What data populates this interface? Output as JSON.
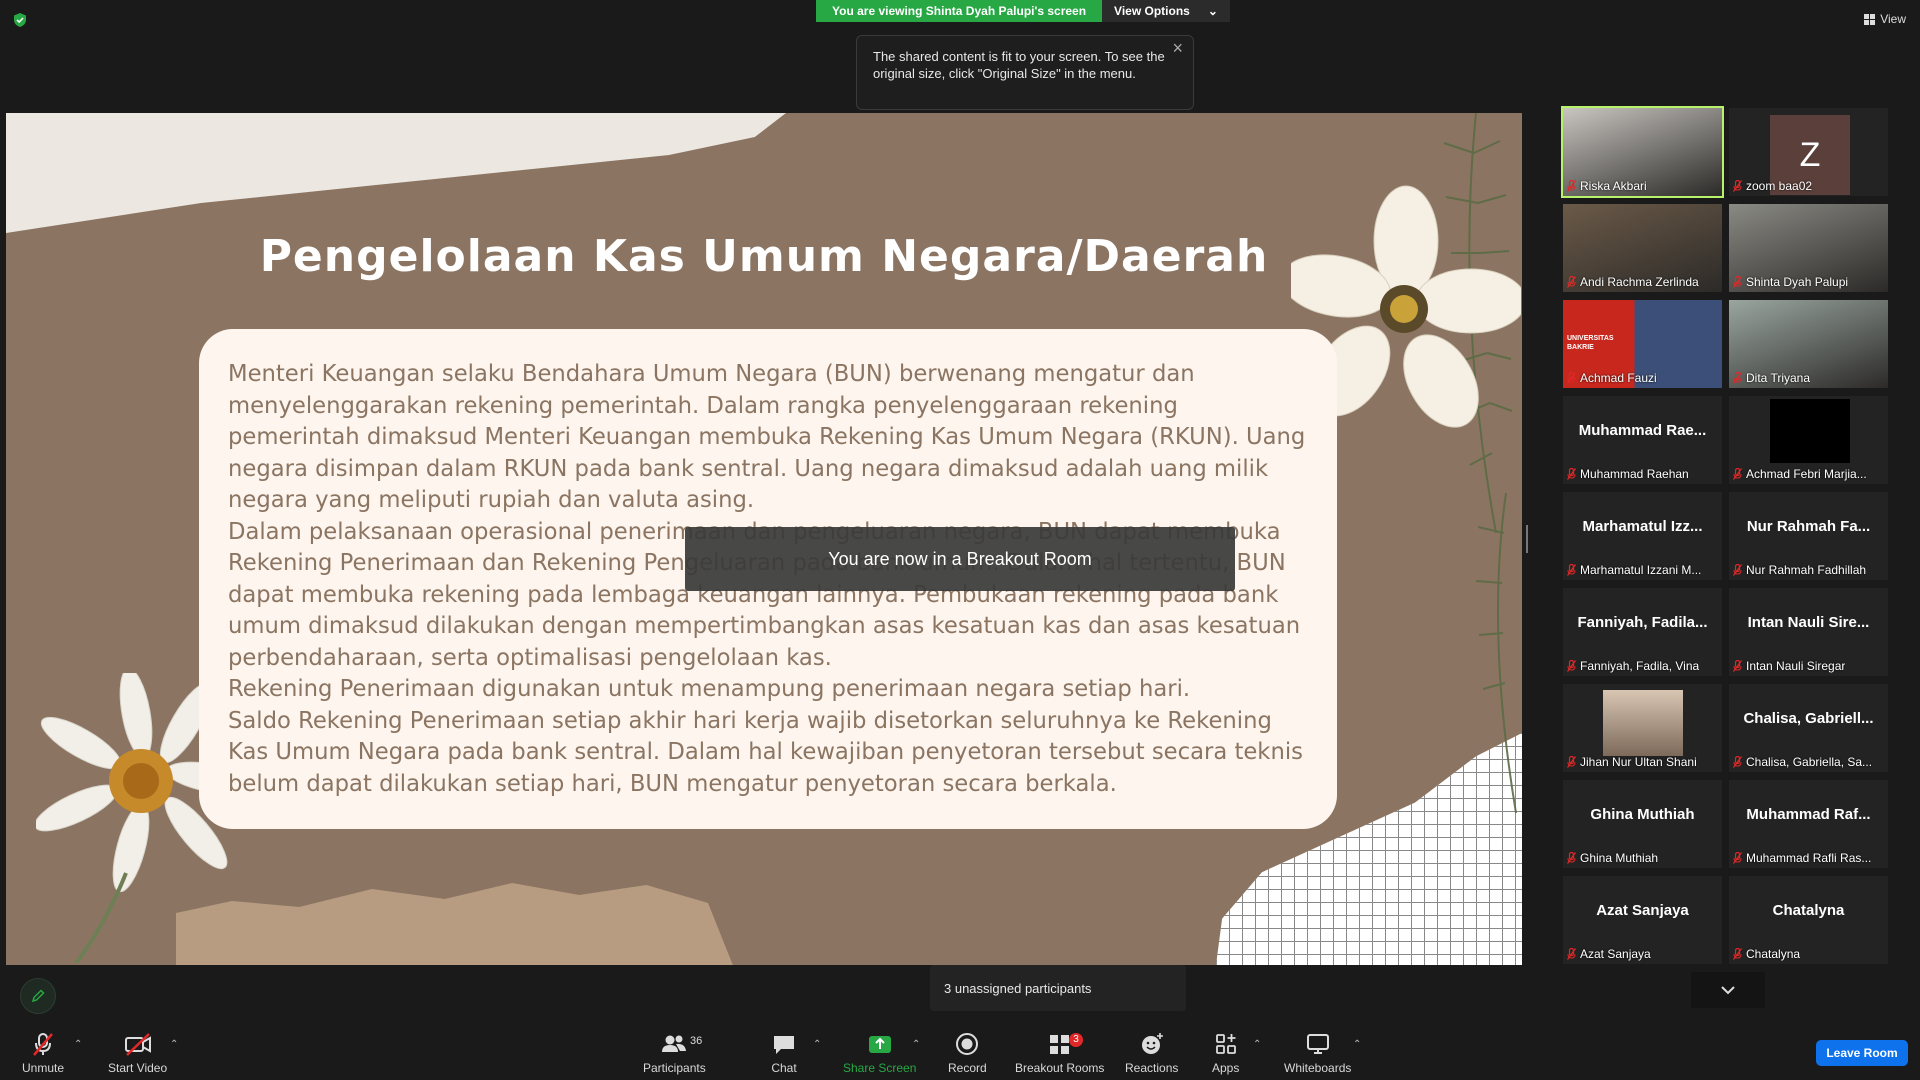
{
  "banner": {
    "viewing_text": "You are viewing Shinta Dyah Palupi's screen",
    "view_options_label": "View Options"
  },
  "tooltip": {
    "text": "The shared content is fit to your screen. To see the original size, click \"Original Size\" in the menu."
  },
  "view_button_label": "View",
  "slide": {
    "title": "Pengelolaan Kas Umum Negara/Daerah",
    "paragraphs": [
      "Menteri Keuangan selaku Bendahara Umum Negara (BUN) berwenang mengatur dan menyelenggarakan rekening pemerintah. Dalam rangka penyelenggaraan rekening pemerintah dimaksud Menteri Keuangan membuka Rekening Kas Umum Negara (RKUN). Uang negara disimpan dalam RKUN pada bank sentral. Uang negara dimaksud adalah uang milik negara yang meliputi rupiah dan valuta asing.",
      "Dalam pelaksanaan operasional penerimaan dan pengeluaran negara, BUN dapat membuka Rekening Penerimaan dan Rekening Pengeluaran pada bank umum. Dalam hal tertentu, BUN dapat membuka rekening pada lembaga keuangan lainnya. Pembukaan rekening pada bank umum dimaksud dilakukan dengan mempertimbangkan asas kesatuan kas dan asas kesatuan perbendaharaan, serta optimalisasi pengelolaan kas.",
      "Rekening Penerimaan digunakan untuk menampung penerimaan negara setiap hari.",
      "Saldo Rekening Penerimaan setiap akhir hari kerja wajib disetorkan seluruhnya ke Rekening Kas Umum Negara pada bank sentral. Dalam hal kewajiban penyetoran tersebut secara teknis belum dapat dilakukan setiap hari, BUN mengatur penyetoran secara berkala."
    ]
  },
  "breakout_toast": "You are now in a Breakout Room",
  "unassigned_text": "3 unassigned participants",
  "participants": [
    {
      "label": "Riska Akbari",
      "name": "",
      "media": "video",
      "active": true
    },
    {
      "label": "zoom baa02",
      "name": "",
      "media": "avatar",
      "avatar_letter": "Z"
    },
    {
      "label": "Andi Rachma Zerlinda",
      "name": "",
      "media": "video"
    },
    {
      "label": "Shinta Dyah Palupi",
      "name": "",
      "media": "video"
    },
    {
      "label": "Achmad Fauzi",
      "name": "",
      "media": "video",
      "video_caption": "UNIVERSITAS BAKRIE"
    },
    {
      "label": "Dita Triyana",
      "name": "",
      "media": "video"
    },
    {
      "label": "Muhammad Raehan",
      "name": "Muhammad Rae...",
      "media": "none"
    },
    {
      "label": "Achmad Febri Marjia...",
      "name": "",
      "media": "black"
    },
    {
      "label": "Marhamatul Izzani M...",
      "name": "Marhamatul Izz...",
      "media": "none"
    },
    {
      "label": "Nur Rahmah Fadhillah",
      "name": "Nur Rahmah Fa...",
      "media": "none"
    },
    {
      "label": "Fanniyah, Fadila, Vina",
      "name": "Fanniyah, Fadila...",
      "media": "none"
    },
    {
      "label": "Intan Nauli Siregar",
      "name": "Intan Nauli Sire...",
      "media": "none"
    },
    {
      "label": "Jihan Nur Ultan Shani",
      "name": "",
      "media": "photo"
    },
    {
      "label": "Chalisa, Gabriella, Sa...",
      "name": "Chalisa, Gabriell...",
      "media": "none"
    },
    {
      "label": "Ghina Muthiah",
      "name": "Ghina Muthiah",
      "media": "none"
    },
    {
      "label": "Muhammad Rafli Ras...",
      "name": "Muhammad Raf...",
      "media": "none"
    },
    {
      "label": "Azat Sanjaya",
      "name": "Azat Sanjaya",
      "media": "none"
    },
    {
      "label": "Chatalyna",
      "name": "Chatalyna",
      "media": "none"
    }
  ],
  "toolbar": {
    "unmute": "Unmute",
    "start_video": "Start Video",
    "participants": "Participants",
    "participants_count": "36",
    "chat": "Chat",
    "share_screen": "Share Screen",
    "record": "Record",
    "breakout_rooms": "Breakout Rooms",
    "breakout_badge": "3",
    "reactions": "Reactions",
    "apps": "Apps",
    "whiteboards": "Whiteboards",
    "leave_room": "Leave Room"
  },
  "colors": {
    "share_green": "#27a844",
    "leave_blue": "#0e72ed",
    "active_speaker": "#b7f26a",
    "slide_bg": "#8b7562",
    "card_bg": "#fdf5ee"
  }
}
